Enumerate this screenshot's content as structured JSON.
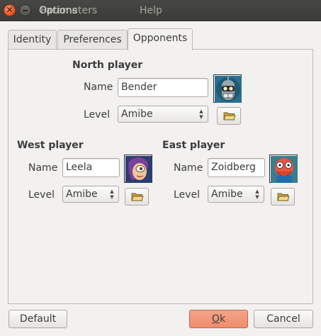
{
  "window": {
    "title": "Options",
    "menu": [
      "Parameters",
      "Help"
    ],
    "close_glyph": "✕"
  },
  "tabs": [
    {
      "label": "Identity",
      "active": false
    },
    {
      "label": "Preferences",
      "active": false
    },
    {
      "label": "Opponents",
      "active": true
    }
  ],
  "labels": {
    "name": "Name",
    "level": "Level"
  },
  "players": {
    "north": {
      "heading": "North player",
      "name": "Bender",
      "level": "Amibe",
      "avatar": "bender-avatar"
    },
    "west": {
      "heading": "West player",
      "name": "Leela",
      "level": "Amibe",
      "avatar": "leela-avatar"
    },
    "east": {
      "heading": "East player",
      "name": "Zoidberg",
      "level": "Amibe",
      "avatar": "zoidberg-avatar"
    }
  },
  "buttons": {
    "default": "Default",
    "ok_mnemonic": "O",
    "ok_rest": "k",
    "cancel": "Cancel"
  },
  "icons": {
    "folder": "folder-open-icon"
  },
  "colors": {
    "titlebar": "#3c3c3a",
    "close": "#e95420",
    "primary_button": "#f0906f",
    "background": "#f2f1f0"
  }
}
